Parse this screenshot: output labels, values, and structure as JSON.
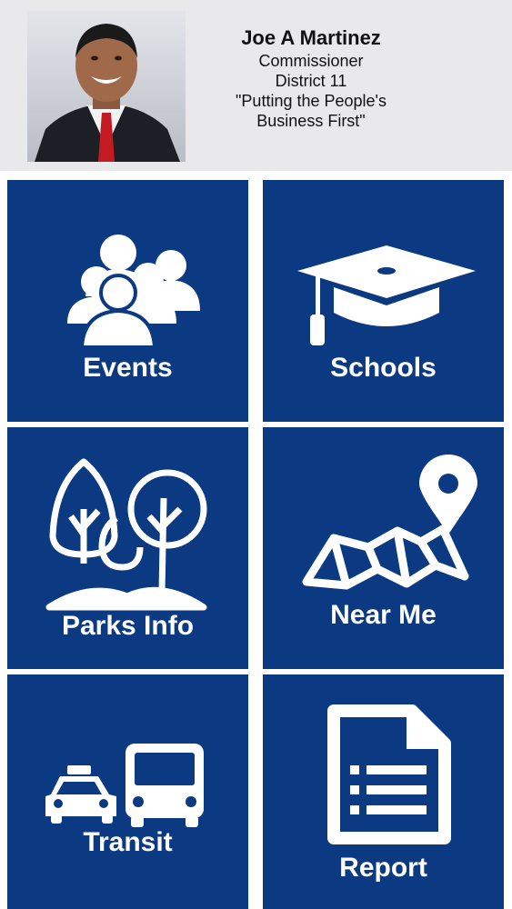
{
  "profile": {
    "name": "Joe A Martinez",
    "title": "Commissioner",
    "district": "District 11",
    "slogan_line1": "\"Putting the People's",
    "slogan_line2": "Business First\""
  },
  "tiles": [
    {
      "label": "Events",
      "icon": "people-group-icon"
    },
    {
      "label": "Schools",
      "icon": "graduation-cap-icon"
    },
    {
      "label": "Parks Info",
      "icon": "trees-icon"
    },
    {
      "label": "Near Me",
      "icon": "map-pin-icon"
    },
    {
      "label": "Transit",
      "icon": "taxi-bus-icon"
    },
    {
      "label": "Report",
      "icon": "document-list-icon"
    }
  ],
  "colors": {
    "tile_background": "#0b3a82",
    "header_background": "#e9e9ec",
    "icon_color": "#ffffff"
  }
}
